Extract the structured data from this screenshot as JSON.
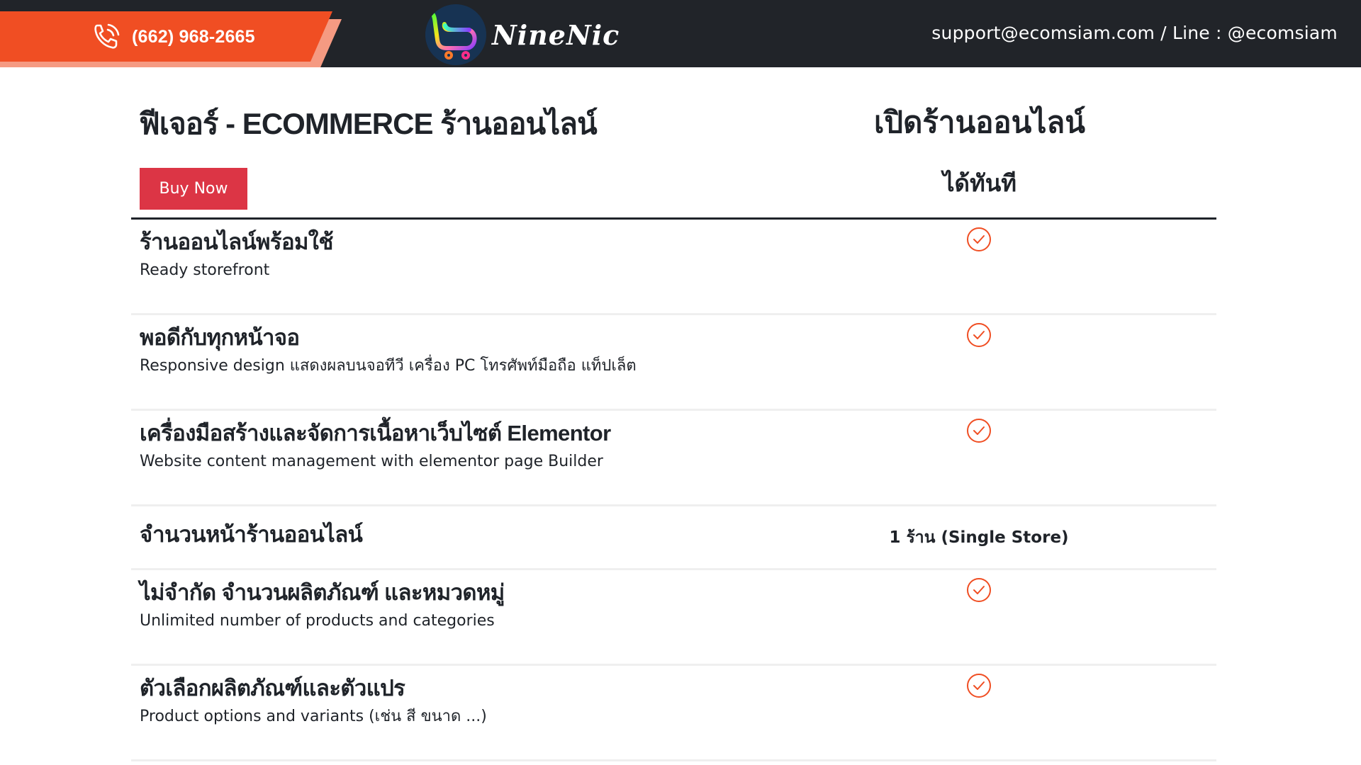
{
  "topbar": {
    "phone": "(662) 968-2665",
    "phone_icon": "phone-call-icon",
    "brand_name": "NineNic",
    "logo_icon": "shopping-cart-icon",
    "contact": "support@ecomsiam.com / Line : @ecomsiam",
    "colors": {
      "background": "#212429",
      "phone_band": "#f04e23",
      "phone_band_shadow": "#f59a82"
    }
  },
  "header": {
    "title": "ฟีเจอร์ - ECOMMERCE ร้านออนไลน์",
    "buy_button": "Buy Now",
    "column_title": "เปิดร้านออนไลน์",
    "column_subtitle": "ได้ทันที",
    "colors": {
      "buy_button": "#dc3545",
      "check": "#f04e23"
    }
  },
  "features": [
    {
      "title": "ร้านออนไลน์พร้อมใช้",
      "subtitle": "Ready storefront",
      "value_type": "check",
      "value_icon": "check-circle-icon"
    },
    {
      "title": "พอดีกับทุกหน้าจอ",
      "subtitle": "Responsive design แสดงผลบนจอทีวี เครื่อง PC โทรศัพท์มือถือ แท็ปเล็ต",
      "value_type": "check",
      "value_icon": "check-circle-icon"
    },
    {
      "title": "เครื่องมือสร้างและจัดการเนื้อหาเว็บไซต์ Elementor",
      "subtitle": "Website content management with elementor page Builder",
      "value_type": "check",
      "value_icon": "check-circle-icon"
    },
    {
      "title": "จำนวนหน้าร้านออนไลน์",
      "subtitle": "",
      "value_type": "text",
      "value": "1 ร้าน (Single Store)"
    },
    {
      "title": "ไม่จำกัด จำนวนผลิตภัณฑ์ และหมวดหมู่",
      "subtitle": "Unlimited number of products and categories",
      "value_type": "check",
      "value_icon": "check-circle-icon"
    },
    {
      "title": "ตัวเลือกผลิตภัณฑ์และตัวแปร",
      "subtitle": "Product options and variants (เช่น สี ขนาด ...)",
      "value_type": "check",
      "value_icon": "check-circle-icon"
    }
  ]
}
